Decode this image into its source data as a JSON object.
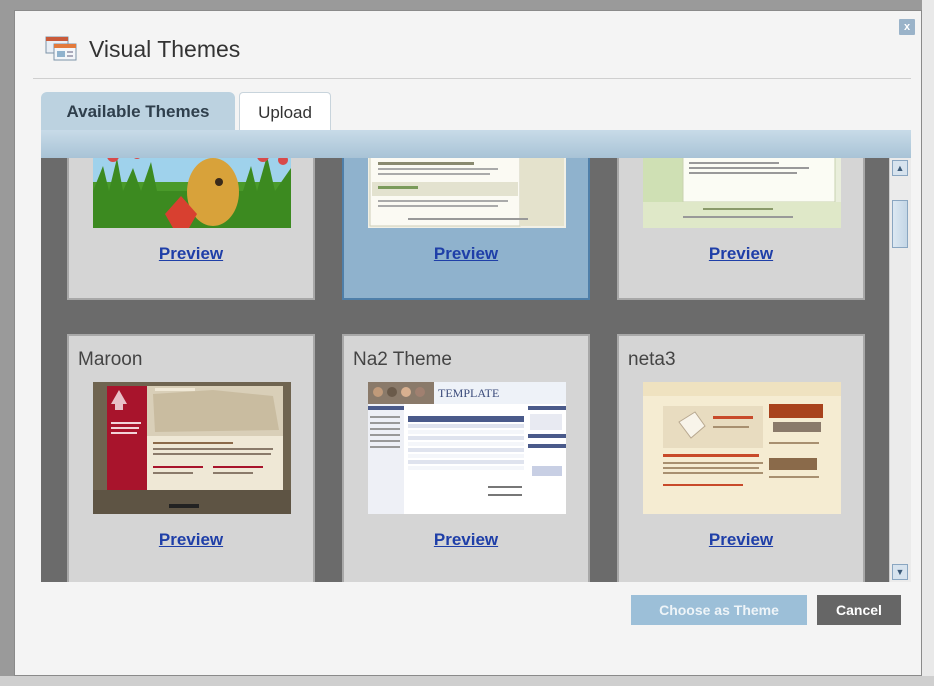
{
  "dialog": {
    "title": "Visual Themes",
    "close_label": "x",
    "title_icon": "visual-themes-icon"
  },
  "tabs": [
    {
      "label": "Available Themes",
      "active": true
    },
    {
      "label": "Upload",
      "active": false
    }
  ],
  "themes": [
    {
      "name": "",
      "preview_label": "Preview",
      "selected": false
    },
    {
      "name": "",
      "preview_label": "Preview",
      "selected": true
    },
    {
      "name": "",
      "preview_label": "Preview",
      "selected": false
    },
    {
      "name": "Maroon",
      "preview_label": "Preview",
      "selected": false
    },
    {
      "name": "Na2 Theme",
      "preview_label": "Preview",
      "selected": false
    },
    {
      "name": "neta3",
      "preview_label": "Preview",
      "selected": false
    }
  ],
  "thumbnail_text": {
    "na2_banner": "TEMPLATE"
  },
  "buttons": {
    "choose": "Choose as Theme",
    "cancel": "Cancel"
  },
  "colors": {
    "accent": "#8fb2cd",
    "link": "#1f3fa8",
    "tab_active": "#bcd2e0"
  }
}
